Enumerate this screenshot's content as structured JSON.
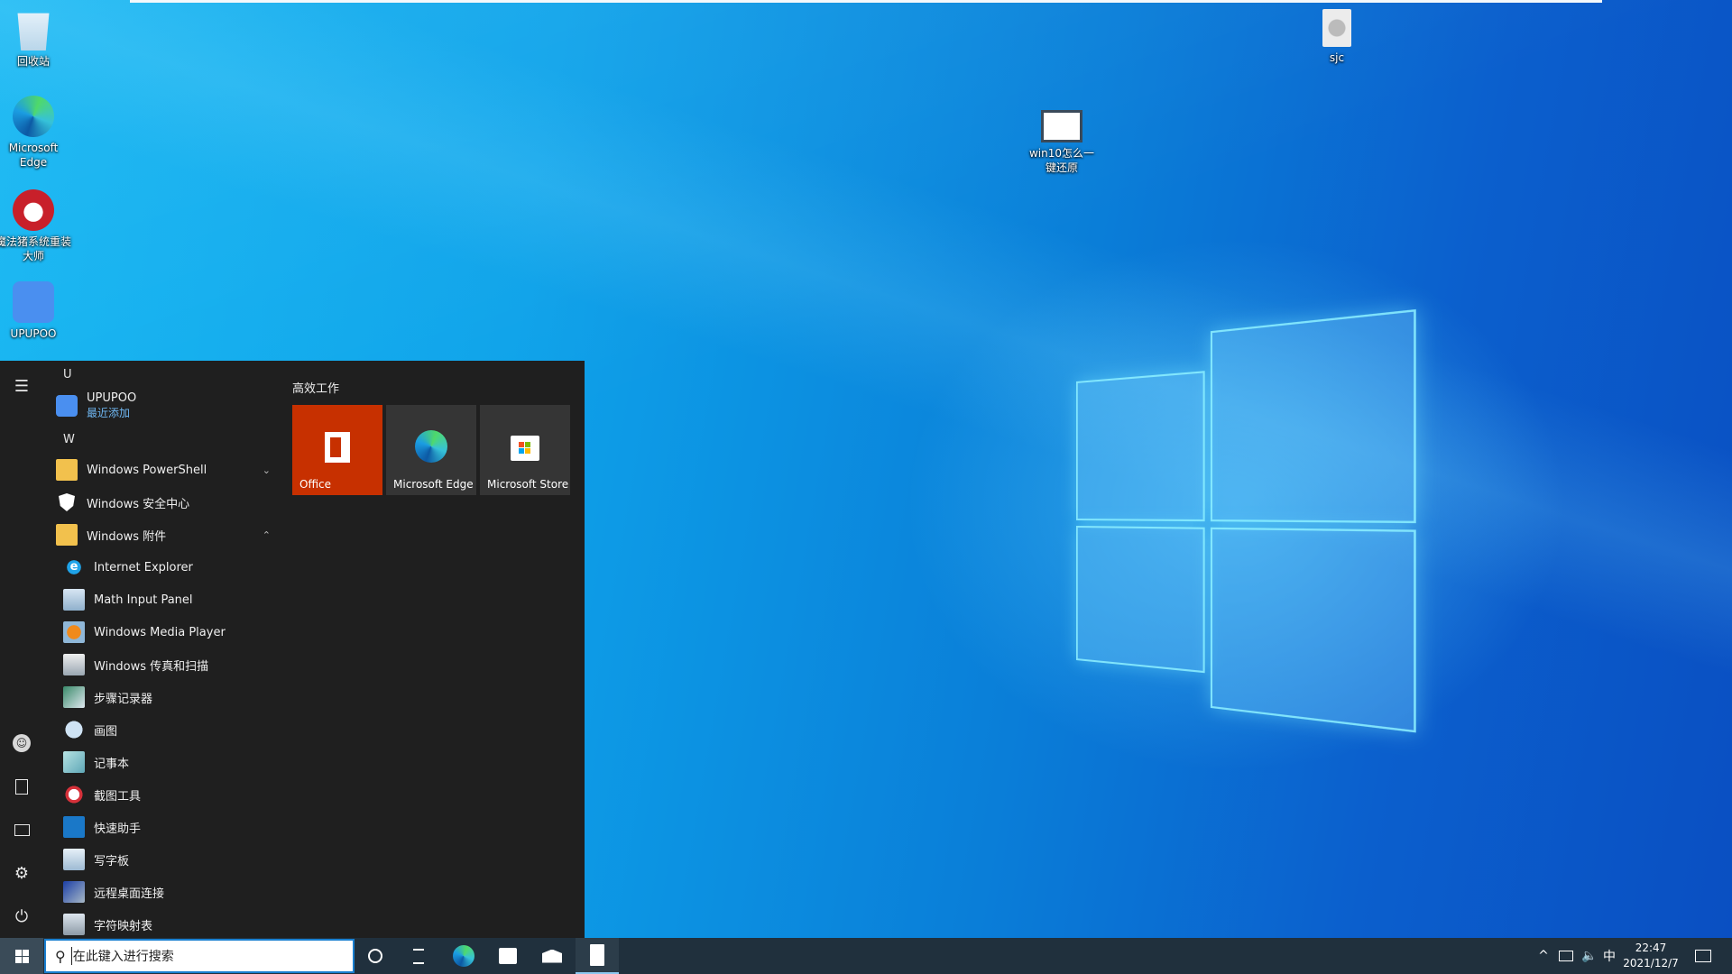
{
  "desktop": {
    "icons": [
      {
        "label": "回收站",
        "icon": "recycle-bin-icon"
      },
      {
        "label": "Microsoft Edge",
        "icon": "edge-icon"
      },
      {
        "label": "魔法猪系统重装大师",
        "icon": "mofazhu-icon"
      },
      {
        "label": "UPUPOO",
        "icon": "upupoo-icon"
      },
      {
        "label": "win10怎么一键还原",
        "icon": "video-file-icon"
      },
      {
        "label": "sjc",
        "icon": "disc-image-icon"
      }
    ]
  },
  "start_menu": {
    "rail": [
      "hamburger-icon",
      "user-icon",
      "documents-icon",
      "pictures-icon",
      "settings-icon",
      "power-icon"
    ],
    "sections": [
      {
        "letter": "U"
      },
      {
        "letter": "W"
      }
    ],
    "apps": [
      {
        "label": "UPUPOO",
        "sublabel": "最近添加",
        "icon": "upupoo-icon"
      },
      {
        "label": "Windows PowerShell",
        "icon": "folder-icon",
        "expander": "collapsed"
      },
      {
        "label": "Windows 安全中心",
        "icon": "shield-icon"
      },
      {
        "label": "Windows 附件",
        "icon": "folder-icon",
        "expander": "expanded"
      },
      {
        "label": "Internet Explorer",
        "icon": "ie-icon"
      },
      {
        "label": "Math Input Panel",
        "icon": "math-input-icon"
      },
      {
        "label": "Windows Media Player",
        "icon": "media-player-icon"
      },
      {
        "label": "Windows 传真和扫描",
        "icon": "fax-scan-icon"
      },
      {
        "label": "步骤记录器",
        "icon": "steps-recorder-icon"
      },
      {
        "label": "画图",
        "icon": "paint-icon"
      },
      {
        "label": "记事本",
        "icon": "notepad-icon"
      },
      {
        "label": "截图工具",
        "icon": "snipping-tool-icon"
      },
      {
        "label": "快速助手",
        "icon": "quick-assist-icon"
      },
      {
        "label": "写字板",
        "icon": "wordpad-icon"
      },
      {
        "label": "远程桌面连接",
        "icon": "remote-desktop-icon"
      },
      {
        "label": "字符映射表",
        "icon": "charmap-icon"
      }
    ],
    "tile_group": {
      "title": "高效工作",
      "tiles": [
        {
          "label": "Office",
          "color": "#c73000"
        },
        {
          "label": "Microsoft Edge",
          "color": "#353535"
        },
        {
          "label": "Microsoft Store",
          "color": "#353535"
        }
      ]
    }
  },
  "taskbar": {
    "search_placeholder": "在此键入进行搜索",
    "pinned": [
      "cortana-icon",
      "task-view-icon",
      "edge-icon",
      "store-icon",
      "mail-icon",
      "calculator-icon"
    ],
    "tray": {
      "ime": "中",
      "time": "22:47",
      "date": "2021/12/7"
    }
  },
  "colors": {
    "accent": "#1a7fd0",
    "start_bg": "#1f1f1f",
    "taskbar_bg": "#20303d",
    "office_tile": "#c73000"
  }
}
